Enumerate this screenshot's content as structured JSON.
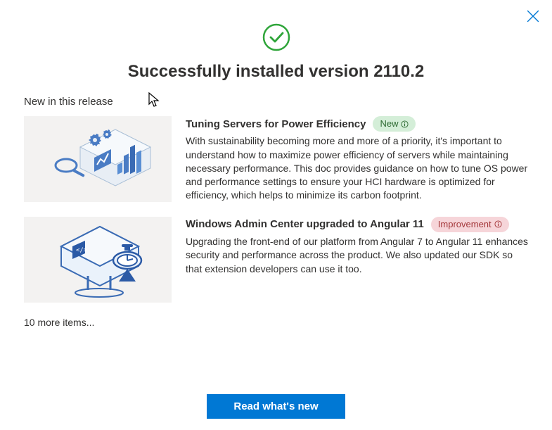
{
  "header": {
    "title": "Successfully installed version 2110.2"
  },
  "section_heading": "New in this release",
  "items": [
    {
      "title": "Tuning Servers for Power Efficiency",
      "badge": "New",
      "badge_type": "new",
      "description": "With sustainability becoming more and more of a priority, it's important to understand how to maximize power efficiency of servers while maintaining necessary performance. This doc provides guidance on how to tune OS power and performance settings to ensure your HCI hardware is optimized for efficiency, which helps to minimize its carbon footprint."
    },
    {
      "title": "Windows Admin Center upgraded to Angular 11",
      "badge": "Improvement",
      "badge_type": "improvement",
      "description": "Upgrading the front-end of our platform from Angular 7 to Angular 11 enhances security and performance across the product. We also updated our SDK so that extension developers can use it too."
    }
  ],
  "more_items": "10 more items...",
  "footer": {
    "button": "Read what's new"
  }
}
